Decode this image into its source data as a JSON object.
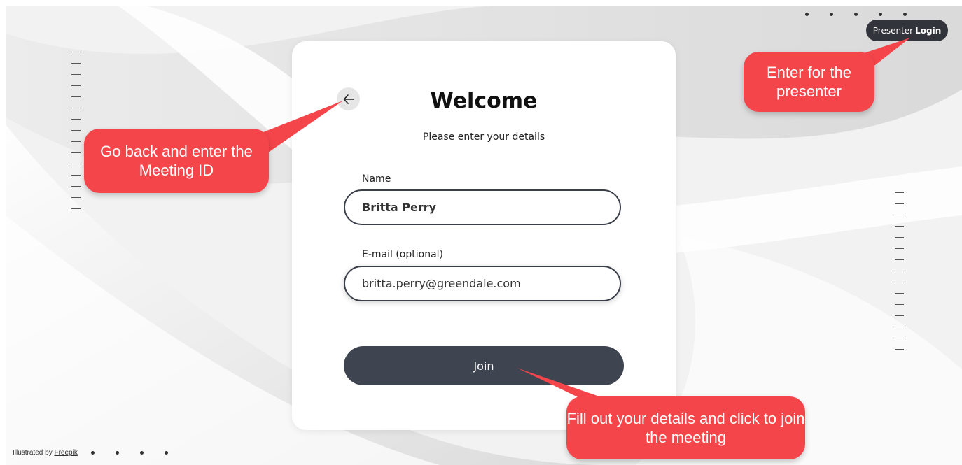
{
  "form": {
    "title": "Welcome",
    "subtitle": "Please enter your details",
    "name_label": "Name",
    "name_value": "Britta Perry",
    "email_label": "E-mail (optional)",
    "email_value": "britta.perry@greendale.com",
    "join_label": "Join"
  },
  "header": {
    "presenter_prefix": "Presenter",
    "presenter_login": "Login"
  },
  "callouts": {
    "back": "Go back and enter the Meeting ID",
    "presenter": "Enter for the presenter",
    "join": "Fill out your details and click to join the meeting"
  },
  "footer": {
    "credit_prefix": "Illustrated by",
    "credit_link": "Freepik"
  },
  "icons": {
    "back": "arrow-left-icon"
  },
  "colors": {
    "callout": "#f4454b",
    "button": "#3f4451",
    "pill": "#32343b"
  }
}
